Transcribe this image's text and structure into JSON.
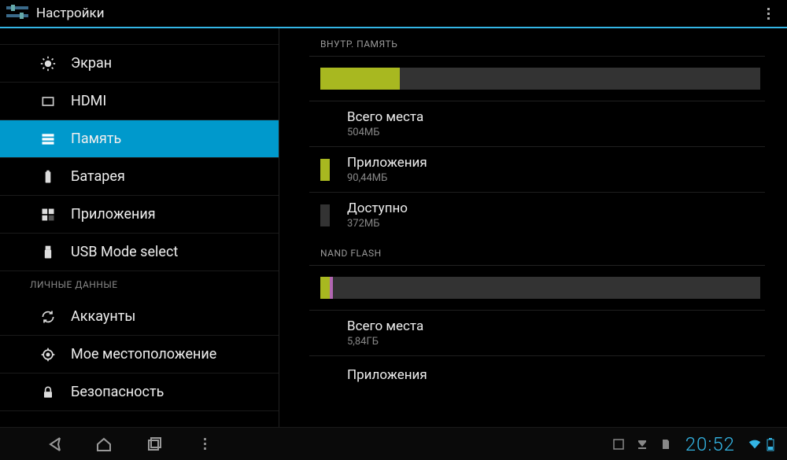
{
  "header": {
    "title": "Настройки"
  },
  "sidebar": {
    "items": [
      {
        "label": "Экран"
      },
      {
        "label": "HDMI"
      },
      {
        "label": "Память"
      },
      {
        "label": "Батарея"
      },
      {
        "label": "Приложения"
      },
      {
        "label": "USB Mode select"
      },
      {
        "label": "Аккаунты"
      },
      {
        "label": "Мое местоположение"
      },
      {
        "label": "Безопасность"
      }
    ],
    "section_personal": "ЛИЧНЫЕ ДАННЫЕ"
  },
  "main": {
    "internal": {
      "header": "ВНУТР. ПАМЯТЬ",
      "bar": [
        {
          "color": "#a8b820",
          "pct": 18
        }
      ],
      "rows": [
        {
          "title": "Всего места",
          "sub": "504МБ",
          "swatch": null
        },
        {
          "title": "Приложения",
          "sub": "90,44МБ",
          "swatch": "#a8b820"
        },
        {
          "title": "Доступно",
          "sub": "372МБ",
          "swatch": "#333"
        }
      ]
    },
    "nand": {
      "header": "NAND FLASH",
      "bar": [
        {
          "color": "#a8b820",
          "pct": 2.2
        },
        {
          "color": "#b266b2",
          "pct": 0.7
        }
      ],
      "rows": [
        {
          "title": "Всего места",
          "sub": "5,84ГБ",
          "swatch": null
        },
        {
          "title": "Приложения",
          "sub": "",
          "swatch": null
        }
      ]
    }
  },
  "clock": "20:52"
}
